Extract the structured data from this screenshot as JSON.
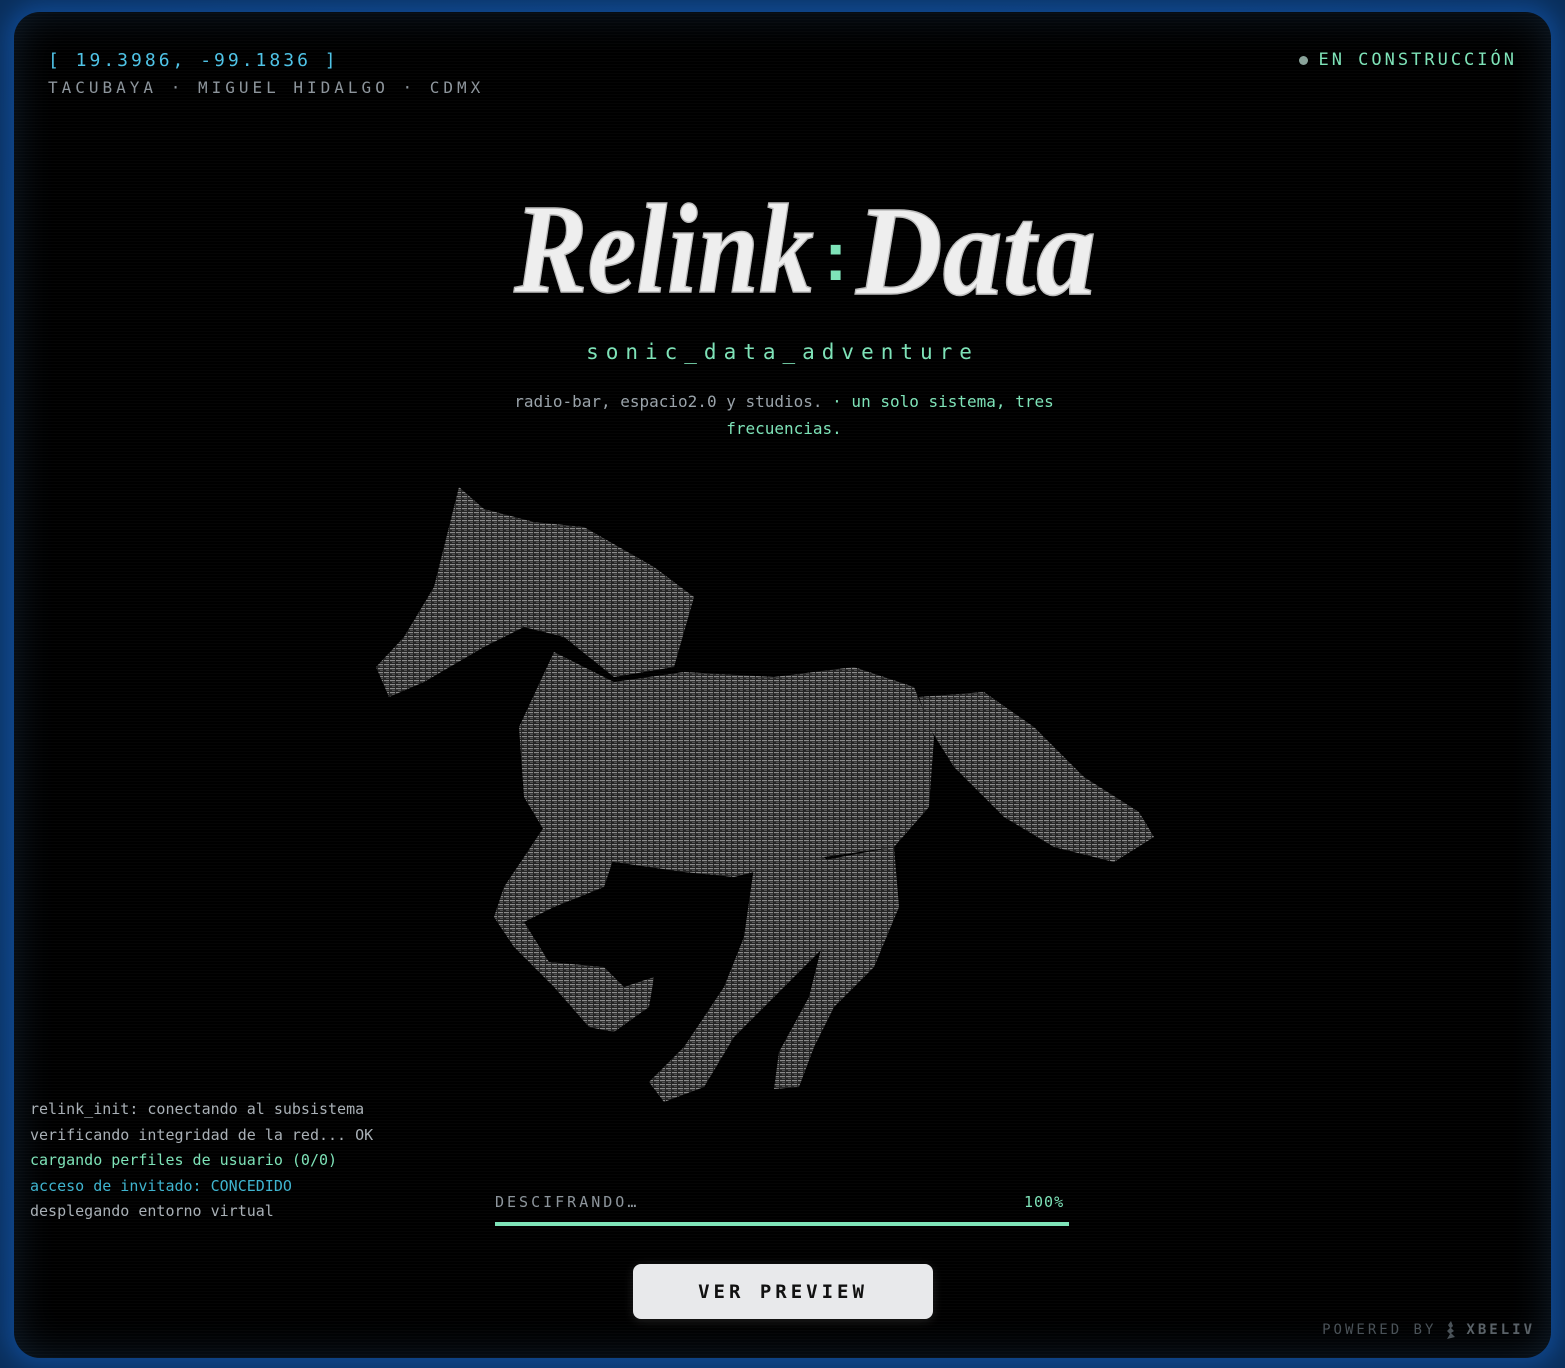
{
  "coords": "[ 19.3986, -99.1836 ]",
  "location": "TACUBAYA · MIGUEL HIDALGO · CDMX",
  "status": {
    "text": "EN CONSTRUCCIÓN"
  },
  "logo": {
    "part1": "Relink",
    "sep": ":",
    "part2": "Data"
  },
  "tagline": "sonic_data_adventure",
  "description": {
    "plain": "radio-bar, espacio2.0 y studios.",
    "highlight": " · un solo sistema, tres frecuencias."
  },
  "console": [
    "relink_init: conectando al subsistema",
    "verificando integridad de la red... OK",
    "cargando perfiles de usuario (0/0)",
    "acceso de invitado: CONCEDIDO",
    "desplegando entorno virtual"
  ],
  "progress": {
    "label": "DESCIFRANDO…",
    "percent_text": "100%",
    "value": 1.0
  },
  "cta": {
    "label": "VER PREVIEW"
  },
  "footer": {
    "powered_by": "POWERED BY",
    "brand": "XBELIV"
  },
  "colors": {
    "accent": "#7ee3b8",
    "cyan": "#4fc3e6",
    "background": "#000000",
    "frame_glow": "#0c3768"
  },
  "icons": {
    "status": "status-dot-icon",
    "footer": "xbeliv-logo-icon",
    "hero": "horse-illustration"
  }
}
